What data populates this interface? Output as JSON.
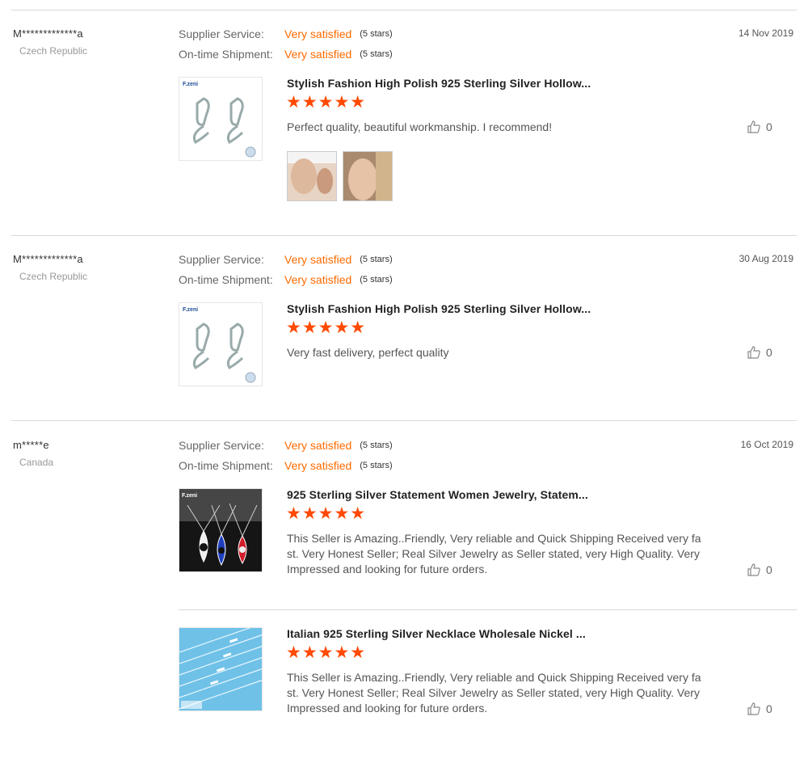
{
  "labels": {
    "supplier_service": "Supplier Service:",
    "ontime_shipment": "On-time Shipment:"
  },
  "reviews": [
    {
      "buyer": "M*************a",
      "country": "Czech Republic",
      "date": "14 Nov 2019",
      "supplier_value": "Very satisfied",
      "supplier_stars": "(5 stars)",
      "shipment_value": "Very satisfied",
      "shipment_stars": "(5 stars)",
      "items": [
        {
          "title": "Stylish Fashion High Polish 925 Sterling Silver Hollow...",
          "stars": "★★★★★",
          "rating": 5,
          "feedback": "Perfect quality, beautiful workmanship. I recommend!",
          "likes": "0",
          "thumb_brand": "F.zeni"
        }
      ]
    },
    {
      "buyer": "M*************a",
      "country": "Czech Republic",
      "date": "30 Aug 2019",
      "supplier_value": "Very satisfied",
      "supplier_stars": "(5 stars)",
      "shipment_value": "Very satisfied",
      "shipment_stars": "(5 stars)",
      "items": [
        {
          "title": "Stylish Fashion High Polish 925 Sterling Silver Hollow...",
          "stars": "★★★★★",
          "rating": 5,
          "feedback": "Very fast delivery, perfect quality",
          "likes": "0",
          "thumb_brand": "F.zeni"
        }
      ]
    },
    {
      "buyer": "m*****e",
      "country": "Canada",
      "date": "16 Oct 2019",
      "supplier_value": "Very satisfied",
      "supplier_stars": "(5 stars)",
      "shipment_value": "Very satisfied",
      "shipment_stars": "(5 stars)",
      "items": [
        {
          "title": "925 Sterling Silver Statement Women Jewelry, Statem...",
          "stars": "★★★★★",
          "rating": 5,
          "feedback": "This Seller is Amazing..Friendly, Very reliable and Quick Shipping Received very fast. Very Honest Seller; Real Silver Jewelry as Seller stated, very High Quality. Very Impressed and looking for future orders.",
          "likes": "0",
          "thumb_brand": "F.zeni"
        },
        {
          "title": "Italian 925 Sterling Silver Necklace Wholesale Nickel ...",
          "stars": "★★★★★",
          "rating": 5,
          "feedback": "This Seller is Amazing..Friendly, Very reliable and Quick Shipping Received very fast. Very Honest Seller; Real Silver Jewelry as Seller stated, very High Quality. Very Impressed and looking for future orders.",
          "likes": "0"
        }
      ]
    }
  ],
  "colors": {
    "accent_orange": "#ff6a00",
    "star_orange": "#ff4a00",
    "separator": "#d9d9d9"
  },
  "icons": {
    "like": "thumbs-up-icon",
    "star": "star-icon"
  }
}
